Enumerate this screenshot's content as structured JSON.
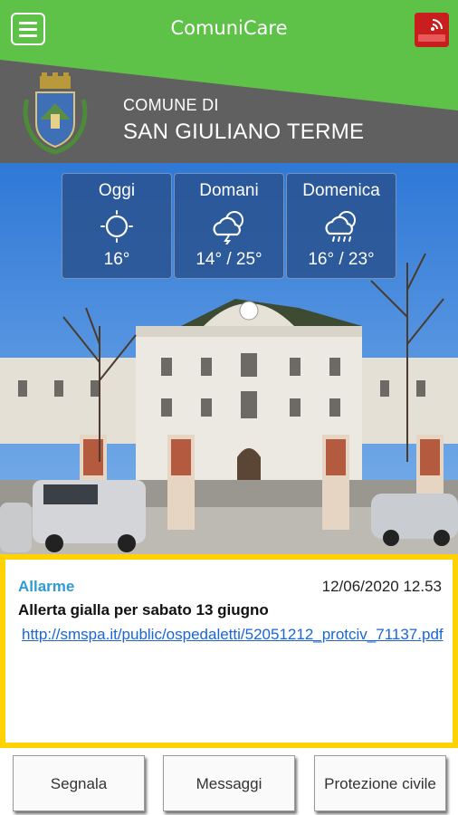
{
  "appbar": {
    "title": "ComuniCare"
  },
  "municipality": {
    "line1": "COMUNE DI",
    "line2": "SAN GIULIANO TERME"
  },
  "weather": [
    {
      "day": "Oggi",
      "icon": "sun-icon",
      "temp": "16°"
    },
    {
      "day": "Domani",
      "icon": "thunderstorm-icon",
      "temp": "14° / 25°"
    },
    {
      "day": "Domenica",
      "icon": "rain-icon",
      "temp": "16° / 23°"
    }
  ],
  "message": {
    "category": "Allarme",
    "datetime": "12/06/2020 12.53",
    "title": "Allerta gialla  per sabato 13 giugno",
    "link": "http://smspa.it/public/ospedaletti/52051212_protciv_71137.pdf"
  },
  "buttons": [
    {
      "label": "Segnala"
    },
    {
      "label": "Messaggi"
    },
    {
      "label": "Protezione civile"
    }
  ],
  "colors": {
    "appbar": "#5fc248",
    "header": "#606060",
    "alert_border": "#ffd200",
    "category": "#2f9bd6",
    "link": "#1b65d6"
  }
}
